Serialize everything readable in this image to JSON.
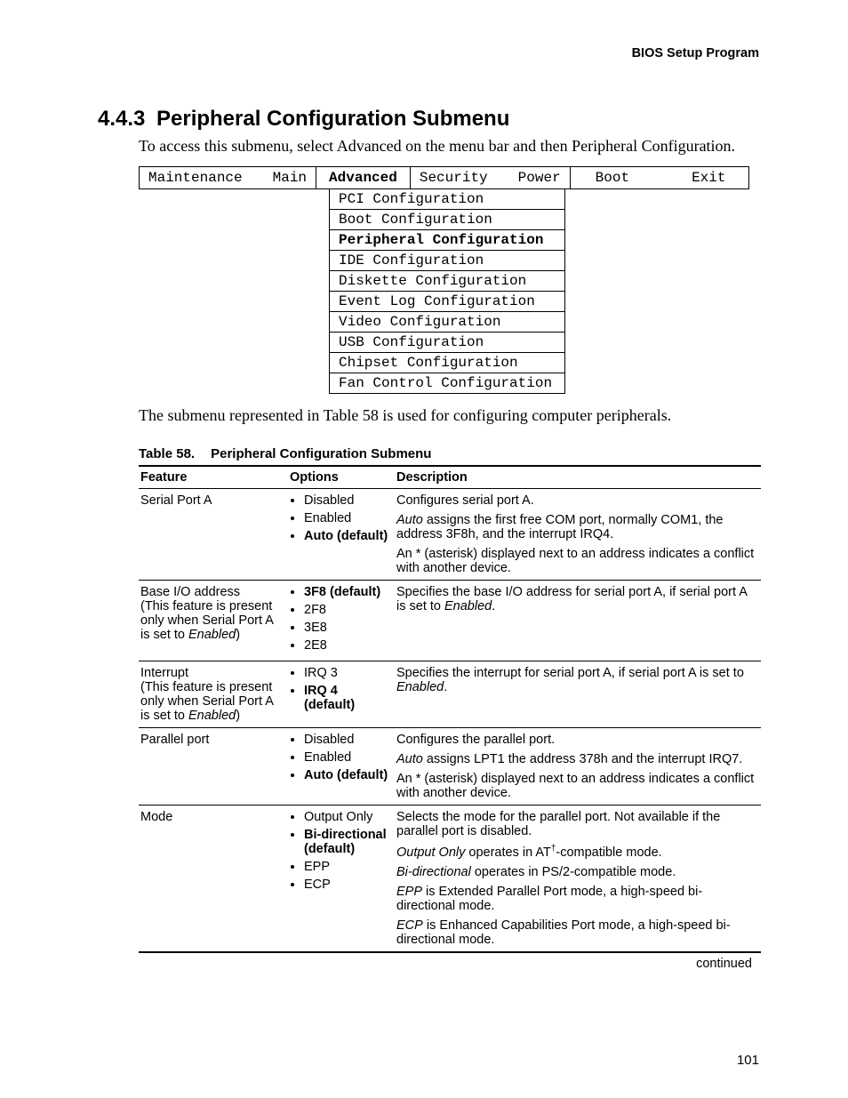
{
  "running_head": "BIOS Setup Program",
  "section": {
    "number": "4.4.3",
    "title": "Peripheral Configuration Submenu"
  },
  "intro": "To access this submenu, select Advanced on the menu bar and then Peripheral Configuration.",
  "menubar": {
    "cell1a": "Maintenance",
    "cell1b": "Main",
    "cell2": "Advanced",
    "cell3a": "Security",
    "cell3b": "Power",
    "cell4a": "Boot",
    "cell4b": "Exit"
  },
  "submenu_items": {
    "i0": "PCI Configuration",
    "i1": "Boot Configuration",
    "i2": "Peripheral Configuration",
    "i3": "IDE Configuration",
    "i4": "Diskette Configuration",
    "i5": "Event Log Configuration",
    "i6": "Video Configuration",
    "i7": "USB Configuration",
    "i8": "Chipset Configuration",
    "i9": "Fan Control Configuration"
  },
  "body_text": "The submenu represented in Table 58 is used for configuring computer peripherals.",
  "table_caption": {
    "number": "Table 58.",
    "title": "Peripheral Configuration Submenu"
  },
  "headers": {
    "feature": "Feature",
    "options": "Options",
    "description": "Description"
  },
  "rows": {
    "r0": {
      "feature": "Serial Port A",
      "opts": {
        "o0": "Disabled",
        "o1": "Enabled",
        "o2": "Auto (default)"
      },
      "desc": {
        "p0": "Configures serial port A.",
        "p1a": "Auto",
        "p1b": " assigns the first free COM port, normally COM1, the address 3F8h, and the interrupt IRQ4.",
        "p2": "An * (asterisk) displayed next to an address indicates a conflict with another device."
      }
    },
    "r1": {
      "feature_line1": "Base I/O address",
      "feature_line2a": "(This feature is present only when Serial Port A is set to ",
      "feature_line2b": "Enabled",
      "feature_line2c": ")",
      "opts": {
        "o0": "3F8 (default)",
        "o1": "2F8",
        "o2": "3E8",
        "o3": "2E8"
      },
      "desc": {
        "p0a": "Specifies the base I/O address for serial port A, if serial port A is set to ",
        "p0b": "Enabled",
        "p0c": "."
      }
    },
    "r2": {
      "feature_line1": "Interrupt",
      "feature_line2a": "(This feature is present only when Serial Port A is set to ",
      "feature_line2b": "Enabled",
      "feature_line2c": ")",
      "opts": {
        "o0": "IRQ 3",
        "o1": "IRQ 4 (default)"
      },
      "desc": {
        "p0a": "Specifies the interrupt for serial port A, if serial port A is set to ",
        "p0b": "Enabled",
        "p0c": "."
      }
    },
    "r3": {
      "feature": "Parallel port",
      "opts": {
        "o0": "Disabled",
        "o1": "Enabled",
        "o2": "Auto (default)"
      },
      "desc": {
        "p0": "Configures the parallel port.",
        "p1a": "Auto",
        "p1b": " assigns LPT1 the address 378h and the interrupt IRQ7.",
        "p2": "An * (asterisk) displayed next to an address indicates a conflict with another device."
      }
    },
    "r4": {
      "feature": "Mode",
      "opts": {
        "o0": "Output Only",
        "o1": "Bi-directional (default)",
        "o2": "EPP",
        "o3": "ECP"
      },
      "desc": {
        "p0": "Selects the mode for the parallel port.  Not available if the parallel port is disabled.",
        "p1a": "Output Only",
        "p1b": " operates in AT",
        "p1sup": "†",
        "p1c": "-compatible mode.",
        "p2a": "Bi-directional",
        "p2b": " operates in PS/2-compatible mode.",
        "p3a": "EPP",
        "p3b": " is Extended Parallel Port mode, a high-speed bi-directional mode.",
        "p4a": "ECP",
        "p4b": " is Enhanced Capabilities Port mode, a high-speed bi-directional mode."
      }
    }
  },
  "continued": "continued",
  "page_number": "101"
}
